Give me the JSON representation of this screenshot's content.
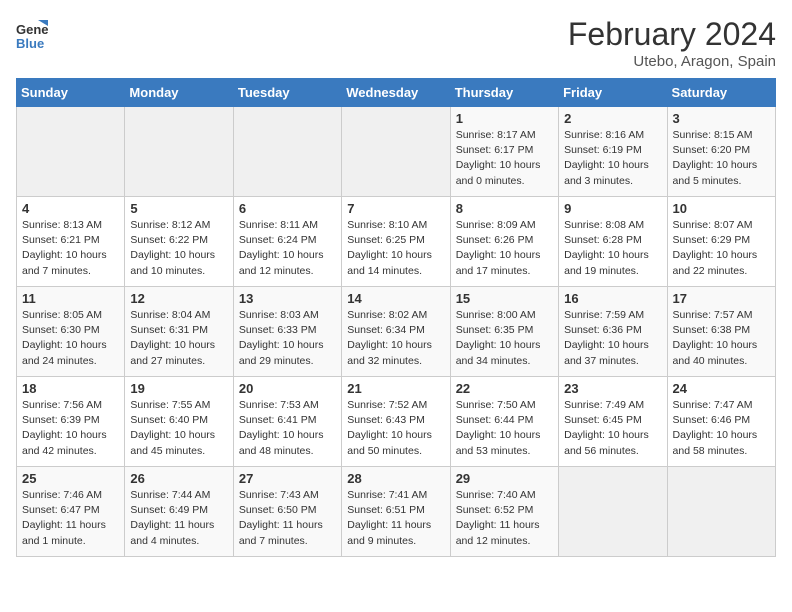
{
  "header": {
    "logo_general": "General",
    "logo_blue": "Blue",
    "month_title": "February 2024",
    "subtitle": "Utebo, Aragon, Spain"
  },
  "days_of_week": [
    "Sunday",
    "Monday",
    "Tuesday",
    "Wednesday",
    "Thursday",
    "Friday",
    "Saturday"
  ],
  "weeks": [
    [
      {
        "day": null
      },
      {
        "day": null
      },
      {
        "day": null
      },
      {
        "day": null
      },
      {
        "day": 1,
        "sunrise": "8:17 AM",
        "sunset": "6:17 PM",
        "daylight": "10 hours and 0 minutes."
      },
      {
        "day": 2,
        "sunrise": "8:16 AM",
        "sunset": "6:19 PM",
        "daylight": "10 hours and 3 minutes."
      },
      {
        "day": 3,
        "sunrise": "8:15 AM",
        "sunset": "6:20 PM",
        "daylight": "10 hours and 5 minutes."
      }
    ],
    [
      {
        "day": 4,
        "sunrise": "8:13 AM",
        "sunset": "6:21 PM",
        "daylight": "10 hours and 7 minutes."
      },
      {
        "day": 5,
        "sunrise": "8:12 AM",
        "sunset": "6:22 PM",
        "daylight": "10 hours and 10 minutes."
      },
      {
        "day": 6,
        "sunrise": "8:11 AM",
        "sunset": "6:24 PM",
        "daylight": "10 hours and 12 minutes."
      },
      {
        "day": 7,
        "sunrise": "8:10 AM",
        "sunset": "6:25 PM",
        "daylight": "10 hours and 14 minutes."
      },
      {
        "day": 8,
        "sunrise": "8:09 AM",
        "sunset": "6:26 PM",
        "daylight": "10 hours and 17 minutes."
      },
      {
        "day": 9,
        "sunrise": "8:08 AM",
        "sunset": "6:28 PM",
        "daylight": "10 hours and 19 minutes."
      },
      {
        "day": 10,
        "sunrise": "8:07 AM",
        "sunset": "6:29 PM",
        "daylight": "10 hours and 22 minutes."
      }
    ],
    [
      {
        "day": 11,
        "sunrise": "8:05 AM",
        "sunset": "6:30 PM",
        "daylight": "10 hours and 24 minutes."
      },
      {
        "day": 12,
        "sunrise": "8:04 AM",
        "sunset": "6:31 PM",
        "daylight": "10 hours and 27 minutes."
      },
      {
        "day": 13,
        "sunrise": "8:03 AM",
        "sunset": "6:33 PM",
        "daylight": "10 hours and 29 minutes."
      },
      {
        "day": 14,
        "sunrise": "8:02 AM",
        "sunset": "6:34 PM",
        "daylight": "10 hours and 32 minutes."
      },
      {
        "day": 15,
        "sunrise": "8:00 AM",
        "sunset": "6:35 PM",
        "daylight": "10 hours and 34 minutes."
      },
      {
        "day": 16,
        "sunrise": "7:59 AM",
        "sunset": "6:36 PM",
        "daylight": "10 hours and 37 minutes."
      },
      {
        "day": 17,
        "sunrise": "7:57 AM",
        "sunset": "6:38 PM",
        "daylight": "10 hours and 40 minutes."
      }
    ],
    [
      {
        "day": 18,
        "sunrise": "7:56 AM",
        "sunset": "6:39 PM",
        "daylight": "10 hours and 42 minutes."
      },
      {
        "day": 19,
        "sunrise": "7:55 AM",
        "sunset": "6:40 PM",
        "daylight": "10 hours and 45 minutes."
      },
      {
        "day": 20,
        "sunrise": "7:53 AM",
        "sunset": "6:41 PM",
        "daylight": "10 hours and 48 minutes."
      },
      {
        "day": 21,
        "sunrise": "7:52 AM",
        "sunset": "6:43 PM",
        "daylight": "10 hours and 50 minutes."
      },
      {
        "day": 22,
        "sunrise": "7:50 AM",
        "sunset": "6:44 PM",
        "daylight": "10 hours and 53 minutes."
      },
      {
        "day": 23,
        "sunrise": "7:49 AM",
        "sunset": "6:45 PM",
        "daylight": "10 hours and 56 minutes."
      },
      {
        "day": 24,
        "sunrise": "7:47 AM",
        "sunset": "6:46 PM",
        "daylight": "10 hours and 58 minutes."
      }
    ],
    [
      {
        "day": 25,
        "sunrise": "7:46 AM",
        "sunset": "6:47 PM",
        "daylight": "11 hours and 1 minute."
      },
      {
        "day": 26,
        "sunrise": "7:44 AM",
        "sunset": "6:49 PM",
        "daylight": "11 hours and 4 minutes."
      },
      {
        "day": 27,
        "sunrise": "7:43 AM",
        "sunset": "6:50 PM",
        "daylight": "11 hours and 7 minutes."
      },
      {
        "day": 28,
        "sunrise": "7:41 AM",
        "sunset": "6:51 PM",
        "daylight": "11 hours and 9 minutes."
      },
      {
        "day": 29,
        "sunrise": "7:40 AM",
        "sunset": "6:52 PM",
        "daylight": "11 hours and 12 minutes."
      },
      {
        "day": null
      },
      {
        "day": null
      }
    ]
  ]
}
